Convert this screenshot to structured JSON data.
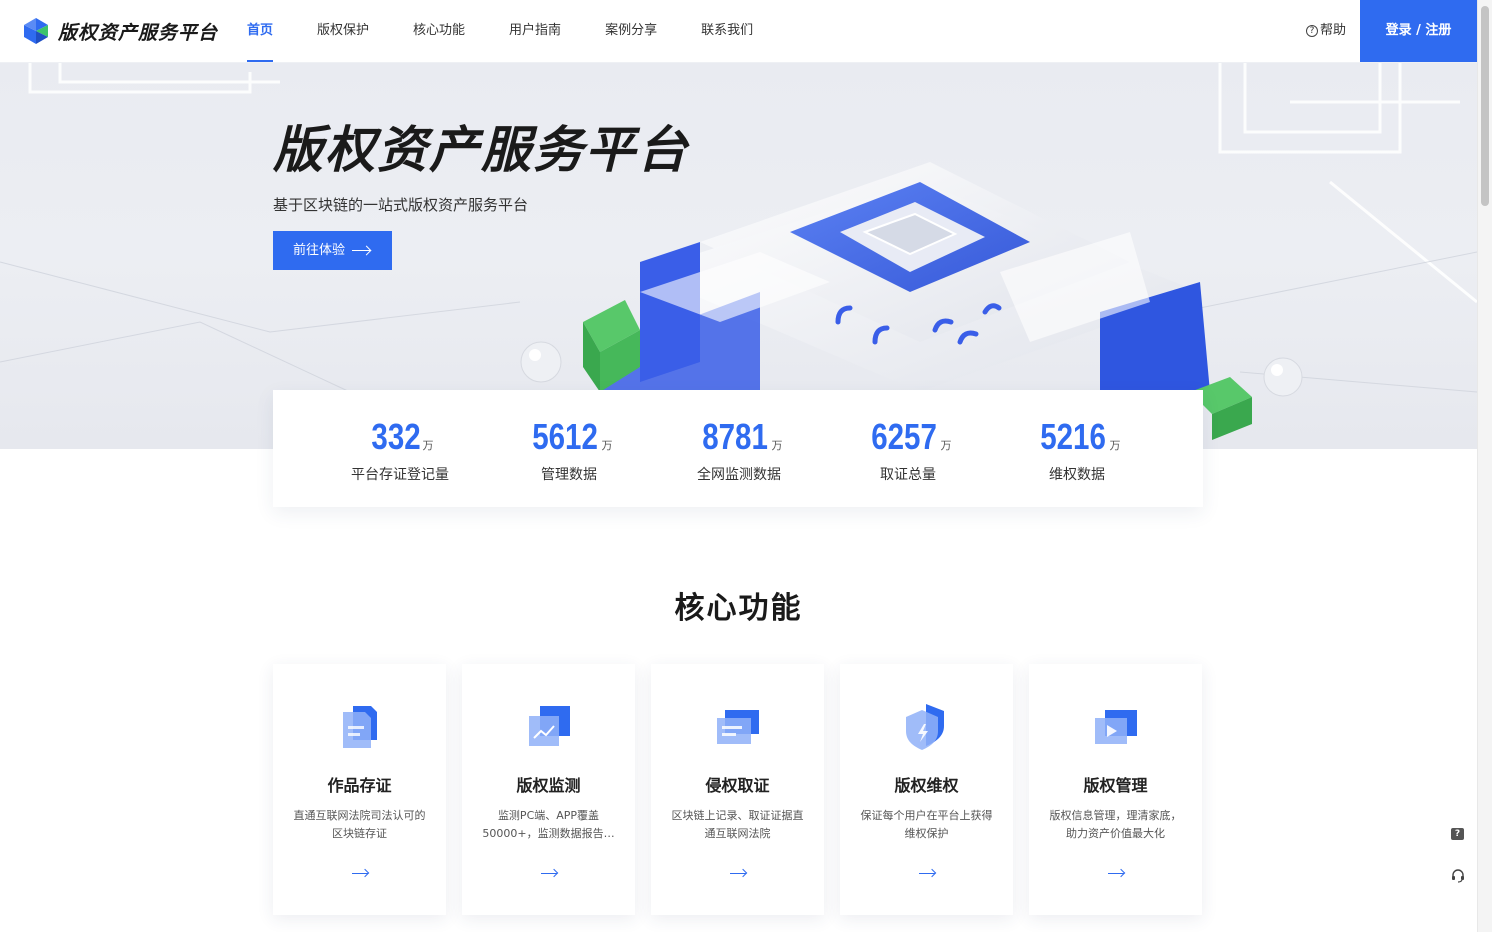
{
  "header": {
    "logo_text": "版权资产服务平台",
    "nav": [
      {
        "label": "首页",
        "active": true
      },
      {
        "label": "版权保护"
      },
      {
        "label": "核心功能"
      },
      {
        "label": "用户指南"
      },
      {
        "label": "案例分享"
      },
      {
        "label": "联系我们"
      }
    ],
    "help_label": "帮助",
    "login_label": "登录 / 注册"
  },
  "hero": {
    "title": "版权资产服务平台",
    "subtitle": "基于区块链的一站式版权资产服务平台",
    "cta_label": "前往体验"
  },
  "stats": [
    {
      "value": "332",
      "unit": "万",
      "label": "平台存证登记量"
    },
    {
      "value": "5612",
      "unit": "万",
      "label": "管理数据"
    },
    {
      "value": "8781",
      "unit": "万",
      "label": "全网监测数据"
    },
    {
      "value": "6257",
      "unit": "万",
      "label": "取证总量"
    },
    {
      "value": "5216",
      "unit": "万",
      "label": "维权数据"
    }
  ],
  "core": {
    "title": "核心功能",
    "cards": [
      {
        "title": "作品存证",
        "desc": "直通互联网法院司法认可的区块链存证",
        "icon": "document-icon"
      },
      {
        "title": "版权监测",
        "desc": "监测PC端、APP覆盖50000+，监测数据报告…",
        "icon": "chart-icon"
      },
      {
        "title": "侵权取证",
        "desc": "区块链上记录、取证证据直通互联网法院",
        "icon": "evidence-icon"
      },
      {
        "title": "版权维权",
        "desc": "保证每个用户在平台上获得维权保护",
        "icon": "shield-icon"
      },
      {
        "title": "版权管理",
        "desc": "版权信息管理，理清家底，助力资产价值最大化",
        "icon": "video-icon"
      }
    ]
  },
  "floating": {
    "question_glyph": "?"
  },
  "colors": {
    "accent": "#2f6bf0",
    "logo_green": "#3cc46a"
  }
}
